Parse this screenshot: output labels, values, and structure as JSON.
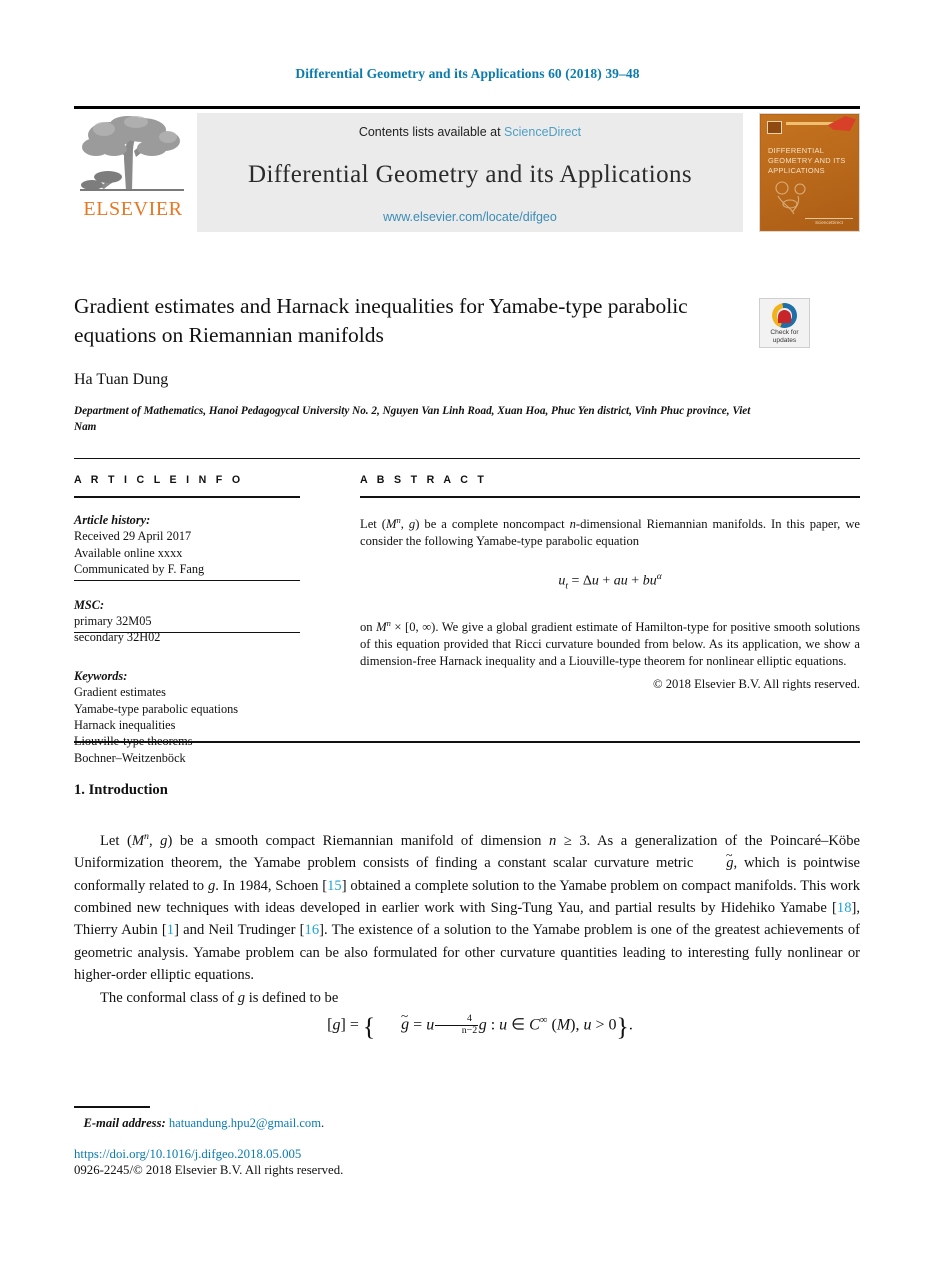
{
  "running_head": "Differential Geometry and its Applications 60 (2018) 39–48",
  "masthead": {
    "publisher_name": "ELSEVIER",
    "contents_prefix": "Contents lists available at",
    "contents_link": "ScienceDirect",
    "journal_title": "Differential Geometry and its Applications",
    "journal_url": "www.elsevier.com/locate/difgeo",
    "cover": {
      "title_lines": [
        "DIFFERENTIAL",
        "GEOMETRY AND ITS",
        "APPLICATIONS"
      ],
      "footer_text": "ScienceDirect"
    },
    "colors": {
      "link_blue": "#4f9fc4",
      "band_gray": "#ebebeb",
      "elsevier_orange": "#e87722",
      "cover_orange": "#b8651a",
      "runhead_blue": "#0b7bae"
    }
  },
  "article": {
    "title": "Gradient estimates and Harnack inequalities for Yamabe-type parabolic equations on Riemannian manifolds",
    "authors": "Ha Tuan Dung",
    "affiliation": "Department of Mathematics, Hanoi Pedagogycal University No. 2, Nguyen Van Linh Road, Xuan Hoa, Phuc Yen district, Vinh Phuc province, Viet Nam",
    "crossmark": {
      "line1": "Check for",
      "line2": "updates"
    }
  },
  "info": {
    "heading": "A R T I C L E   I N F O",
    "history_label": "Article history:",
    "history": [
      "Received 29 April 2017",
      "Available online xxxx",
      "Communicated by F. Fang"
    ],
    "msc_label": "MSC:",
    "msc": [
      "primary 32M05",
      "secondary 32H02"
    ],
    "keywords_label": "Keywords:",
    "keywords": [
      "Gradient estimates",
      "Yamabe-type parabolic equations",
      "Harnack inequalities",
      "Liouville-type theorems",
      "Bochner–Weitzenböck"
    ]
  },
  "abstract": {
    "heading": "A B S T R A C T",
    "para1_a": "Let (",
    "para1_M": "M",
    "para1_n": "n",
    "para1_b": ", ",
    "para1_g": "g",
    "para1_c": ") be a complete noncompact ",
    "para1_nd": "n",
    "para1_d": "-dimensional Riemannian manifolds. In this paper, we consider the following Yamabe-type parabolic equation",
    "equation_plain": "u_t = Δu + au + bu^α",
    "para2_a": "on ",
    "para2_M": "M",
    "para2_n": "n",
    "para2_b": " × [0, ∞). We give a global gradient estimate of Hamilton-type for positive smooth solutions of this equation provided that Ricci curvature bounded from below. As its application, we show a dimension-free Harnack inequality and a Liouville-type theorem for nonlinear elliptic equations.",
    "copyright": "© 2018 Elsevier B.V. All rights reserved."
  },
  "body": {
    "section_number": "1.",
    "section_title": "Introduction",
    "p1_s1": "Let (",
    "p1_M": "M",
    "p1_n": "n",
    "p1_s2": ", ",
    "p1_g": "g",
    "p1_s3": ") be a smooth compact Riemannian manifold of dimension ",
    "p1_dim": "n",
    "p1_s4": " ≥ 3. As a generalization of the Poincaré–Köbe Uniformization theorem, the Yamabe problem consists of finding a constant scalar curvature metric ",
    "p1_gt": "g",
    "p1_s5": ", which is pointwise conformally related to ",
    "p1_g2": "g",
    "p1_s6": ". In 1984, Schoen [",
    "p1_ref15": "15",
    "p1_s7": "] obtained a complete solution to the Yamabe problem on compact manifolds. This work combined new techniques with ideas developed in earlier work with Sing-Tung Yau, and partial results by Hidehiko Yamabe [",
    "p1_ref18": "18",
    "p1_s8": "], Thierry Aubin [",
    "p1_ref1": "1",
    "p1_s9": "] and Neil Trudinger [",
    "p1_ref16": "16",
    "p1_s10": "]. The existence of a solution to the Yamabe problem is one of the greatest achievements of geometric analysis. Yamabe problem can be also formulated for other curvature quantities leading to interesting fully nonlinear or higher-order elliptic equations.",
    "p2_s1": "The conformal class of ",
    "p2_g": "g",
    "p2_s2": " is defined to be",
    "display_equation_plain": "[g] = { g̃ = u^(4/(n-2)) g : u ∈ C∞(M), u > 0 }.",
    "eq_parts": {
      "lhs_open": "[",
      "lhs_g": "g",
      "lhs_close": "]",
      "eq": "=",
      "gtilde": "g",
      "eq2": "=",
      "u": "u",
      "num": "4",
      "den": "n−2",
      "g_right": "g",
      "colon": ":",
      "u2": "u",
      "in": "∈",
      "C": "C",
      "inf": "∞",
      "Mopen": "(",
      "M": "M",
      "Mclose": ")",
      "comma": ",",
      "u3": "u",
      "gt": ">",
      "zero": "0",
      "period": "."
    }
  },
  "footer": {
    "email_label": "E-mail address:",
    "email": "hatuandung.hpu2@gmail.com",
    "email_period": ".",
    "doi": "https://doi.org/10.1016/j.difgeo.2018.05.005",
    "issn_line": "0926-2245/© 2018 Elsevier B.V. All rights reserved."
  }
}
